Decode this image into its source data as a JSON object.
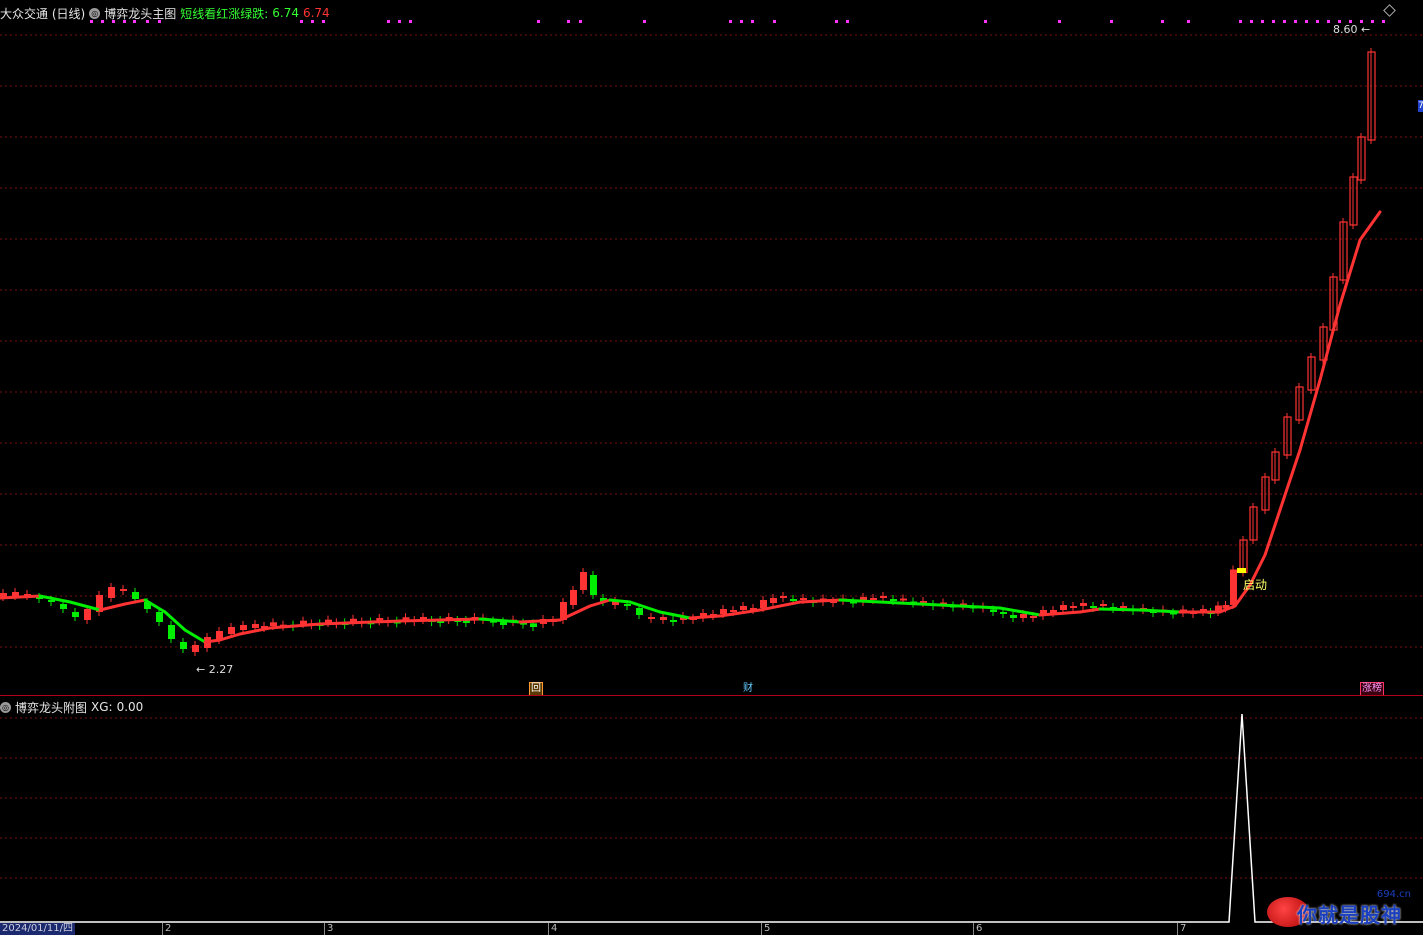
{
  "main_header": {
    "stock": "大众交通 (日线)",
    "indicator_circle": "◎",
    "indicator": "博弈龙头主图",
    "label": "短线看红涨绿跌:",
    "value_green": "6.74",
    "value_red": "6.74"
  },
  "sub_header": {
    "indicator_circle": "◎",
    "indicator": "博弈龙头附图",
    "label": "XG:",
    "value": "0.00"
  },
  "annotations": {
    "high": "8.60",
    "low": "2.27",
    "start": "启动",
    "right_edge_tag": "7"
  },
  "events": {
    "hui": "回",
    "cai": "财",
    "zhangbang": "涨榜"
  },
  "dates": {
    "first": "2024/01/11/四",
    "months": [
      "2",
      "3",
      "4",
      "5",
      "6",
      "7"
    ]
  },
  "watermark": {
    "text": "你就是股神",
    "site": "694.cn"
  },
  "colors": {
    "up": "#ff3333",
    "down": "#00ee00",
    "grid": "#7a1010",
    "signal": "#ffffff"
  },
  "icons": {
    "circle": "collapse-circle-icon",
    "diamond": "diamond-icon"
  },
  "chart_data": {
    "type": "candlestick",
    "y_range_main": [
      2.27,
      8.6
    ],
    "highest_price": 8.6,
    "lowest_price": 2.27,
    "last_value": 6.74,
    "signal_series": {
      "name": "XG",
      "value_shown": 0.0
    }
  }
}
